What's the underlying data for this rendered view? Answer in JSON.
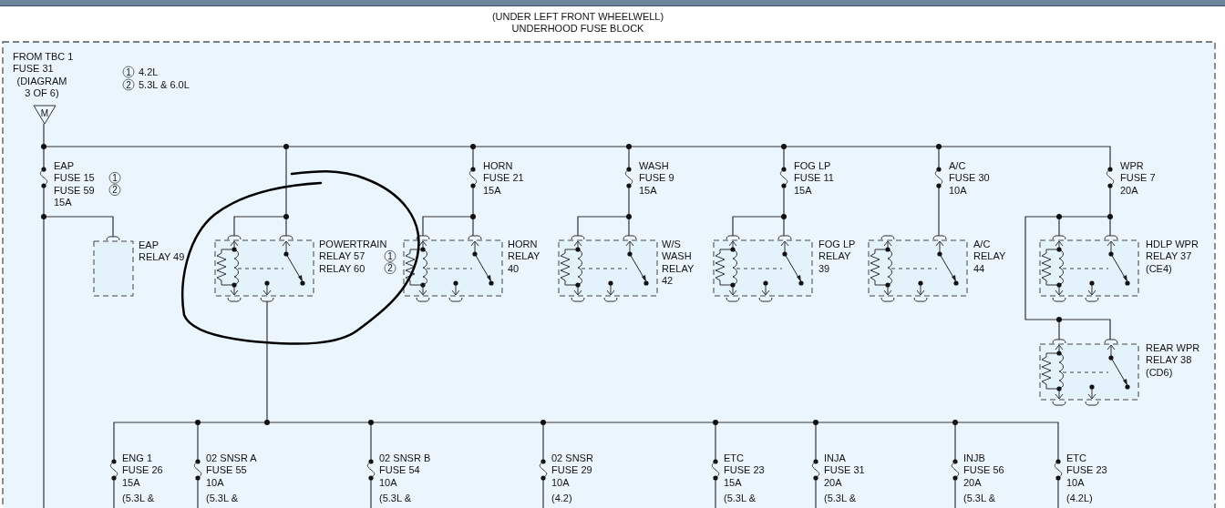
{
  "header": {
    "lines": [
      "(UNDER LEFT FRONT WHEELWELL)",
      "UNDERHOOD FUSE BLOCK"
    ]
  },
  "source": {
    "lines": [
      {
        "text": "FROM TBC 1"
      },
      {
        "text": "FUSE 31"
      },
      {
        "text": "(DIAGRAM"
      },
      {
        "text": "3 OF 6)"
      }
    ],
    "connector": "M"
  },
  "legend": [
    {
      "mark": "1",
      "text": "4.2L"
    },
    {
      "mark": "2",
      "text": "5.3L & 6.0L"
    }
  ],
  "fuses": [
    {
      "lines": [
        {
          "text": "EAP"
        },
        {
          "text": "FUSE 15",
          "mark": "1"
        },
        {
          "text": "FUSE 59",
          "mark": "2"
        },
        {
          "text": "15A"
        }
      ]
    },
    {
      "lines": [
        {
          "text": "HORN"
        },
        {
          "text": "FUSE 21"
        },
        {
          "text": "15A"
        }
      ]
    },
    {
      "lines": [
        {
          "text": "WASH"
        },
        {
          "text": "FUSE 9"
        },
        {
          "text": "15A"
        }
      ]
    },
    {
      "lines": [
        {
          "text": "FOG LP"
        },
        {
          "text": "FUSE 11"
        },
        {
          "text": "15A"
        }
      ]
    },
    {
      "lines": [
        {
          "text": "A/C"
        },
        {
          "text": "FUSE 30"
        },
        {
          "text": "10A"
        }
      ]
    },
    {
      "lines": [
        {
          "text": "WPR"
        },
        {
          "text": "FUSE 7"
        },
        {
          "text": "20A"
        }
      ]
    }
  ],
  "relays": [
    {
      "kind": "empty",
      "lines": [
        {
          "text": "EAP"
        },
        {
          "text": "RELAY 49"
        }
      ]
    },
    {
      "kind": "switch",
      "lines": [
        {
          "text": "POWERTRAIN"
        },
        {
          "text": "RELAY 57",
          "mark": "1"
        },
        {
          "text": "RELAY 60",
          "mark": "2"
        }
      ]
    },
    {
      "kind": "switch",
      "lines": [
        {
          "text": "HORN"
        },
        {
          "text": "RELAY"
        },
        {
          "text": "40"
        }
      ]
    },
    {
      "kind": "switch",
      "lines": [
        {
          "text": "W/S"
        },
        {
          "text": "WASH"
        },
        {
          "text": "RELAY"
        },
        {
          "text": "42"
        }
      ]
    },
    {
      "kind": "switch",
      "lines": [
        {
          "text": "FOG LP"
        },
        {
          "text": "RELAY"
        },
        {
          "text": "39"
        }
      ]
    },
    {
      "kind": "switch",
      "lines": [
        {
          "text": "A/C"
        },
        {
          "text": "RELAY"
        },
        {
          "text": "44"
        }
      ]
    },
    {
      "kind": "switch",
      "lines": [
        {
          "text": "HDLP WPR"
        },
        {
          "text": "RELAY 37"
        },
        {
          "text": "(CE4)"
        }
      ]
    },
    {
      "kind": "switch",
      "lines": [
        {
          "text": "REAR WPR"
        },
        {
          "text": "RELAY 38"
        },
        {
          "text": "(CD6)"
        }
      ]
    }
  ],
  "lower_fuses": [
    {
      "lines": [
        {
          "text": "ENG 1"
        },
        {
          "text": "FUSE 26"
        },
        {
          "text": "15A"
        },
        {
          "text": "(5.3L &"
        }
      ]
    },
    {
      "lines": [
        {
          "text": "02 SNSR A"
        },
        {
          "text": "FUSE 55"
        },
        {
          "text": "10A"
        },
        {
          "text": "(5.3L &"
        }
      ]
    },
    {
      "lines": [
        {
          "text": "02 SNSR B"
        },
        {
          "text": "FUSE 54"
        },
        {
          "text": "10A"
        },
        {
          "text": "(5.3L &"
        }
      ]
    },
    {
      "lines": [
        {
          "text": "02 SNSR"
        },
        {
          "text": "FUSE 29"
        },
        {
          "text": "10A"
        },
        {
          "text": "(4.2)"
        }
      ]
    },
    {
      "lines": [
        {
          "text": "ETC"
        },
        {
          "text": "FUSE 23"
        },
        {
          "text": "15A"
        },
        {
          "text": "(5.3L &"
        }
      ]
    },
    {
      "lines": [
        {
          "text": "INJA"
        },
        {
          "text": "FUSE 31"
        },
        {
          "text": "20A"
        },
        {
          "text": "(5.3L &"
        }
      ]
    },
    {
      "lines": [
        {
          "text": "INJB"
        },
        {
          "text": "FUSE 56"
        },
        {
          "text": "20A"
        },
        {
          "text": "(5.3L &"
        }
      ]
    },
    {
      "lines": [
        {
          "text": "ETC"
        },
        {
          "text": "FUSE 23"
        },
        {
          "text": "10A"
        },
        {
          "text": "(4.2L)"
        }
      ]
    }
  ]
}
